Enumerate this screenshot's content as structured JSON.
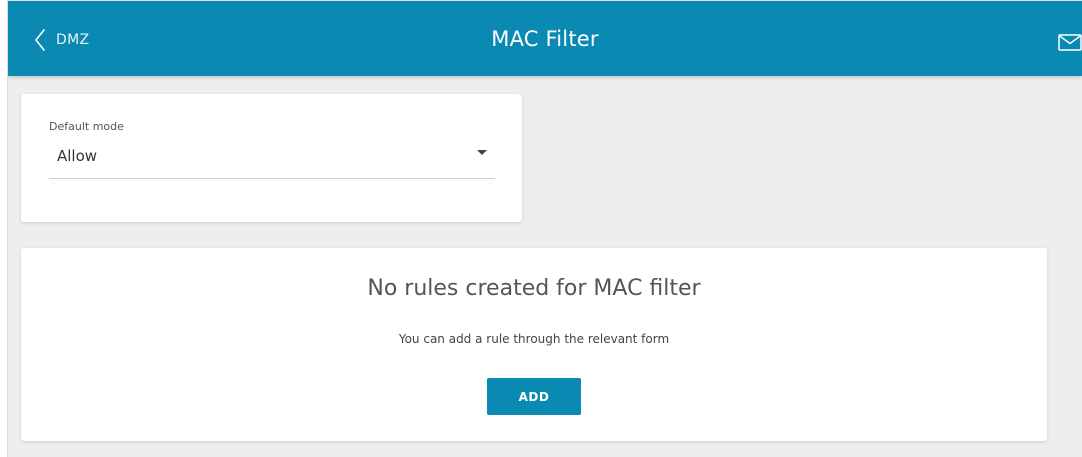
{
  "header": {
    "back_label": "DMZ",
    "back_icon": "chevron-left-icon",
    "title": "MAC Filter",
    "mail_icon": "envelope-icon"
  },
  "default_mode": {
    "label": "Default mode",
    "value": "Allow",
    "dropdown_icon": "caret-down-icon"
  },
  "rules": {
    "empty_title": "No rules created for MAC filter",
    "empty_hint": "You can add a rule through the relevant form",
    "add_label": "ADD"
  },
  "colors": {
    "header_bg": "#0a8ab2",
    "page_bg": "#eeeeee",
    "card_bg": "#ffffff",
    "button_bg": "#0a8ab2"
  }
}
